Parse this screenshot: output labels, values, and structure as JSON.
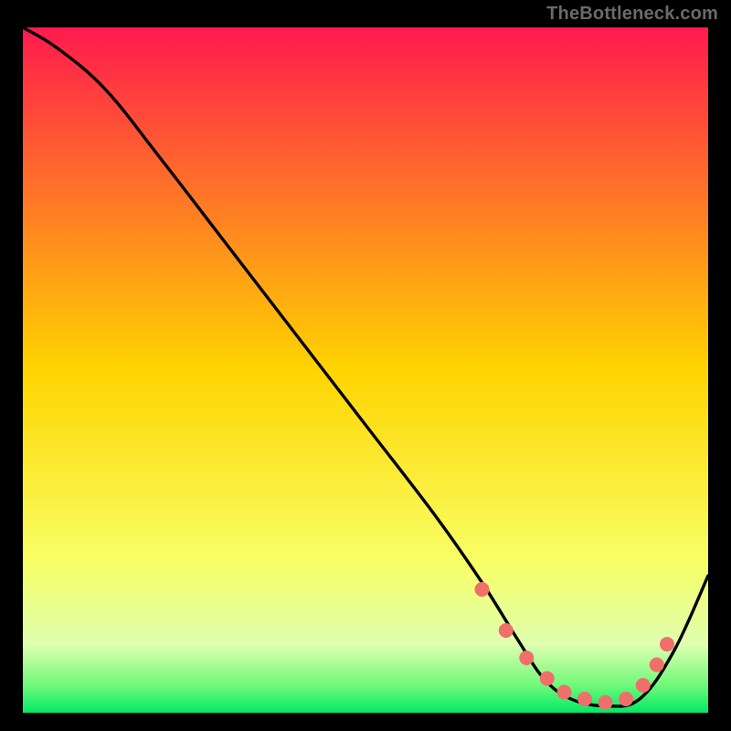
{
  "attribution": "TheBottleneck.com",
  "chart_data": {
    "type": "line",
    "title": "",
    "xlabel": "",
    "ylabel": "",
    "xlim": [
      0,
      100
    ],
    "ylim": [
      0,
      100
    ],
    "grid": false,
    "legend": false,
    "gradient_stops": [
      {
        "offset": 0.0,
        "color": "#ff1a4d"
      },
      {
        "offset": 0.5,
        "color": "#ffd400"
      },
      {
        "offset": 0.78,
        "color": "#f8ff66"
      },
      {
        "offset": 0.9,
        "color": "#dfffb0"
      },
      {
        "offset": 0.96,
        "color": "#70f97a"
      },
      {
        "offset": 1.0,
        "color": "#00e965"
      }
    ],
    "curve": {
      "x": [
        0,
        5,
        12,
        20,
        30,
        40,
        50,
        60,
        67,
        72,
        76,
        80,
        85,
        90,
        95,
        100
      ],
      "y": [
        100,
        97,
        91,
        81,
        68,
        55,
        42,
        29,
        19,
        11,
        5,
        2,
        1,
        2,
        9,
        20
      ]
    },
    "markers": {
      "x": [
        67,
        70.5,
        73.5,
        76.5,
        79,
        82,
        85,
        88,
        90.5,
        92.5,
        94
      ],
      "y": [
        18,
        12,
        8,
        5,
        3,
        2,
        1.5,
        2,
        4,
        7,
        10
      ],
      "color": "#ef6f6b",
      "size": 8
    }
  }
}
